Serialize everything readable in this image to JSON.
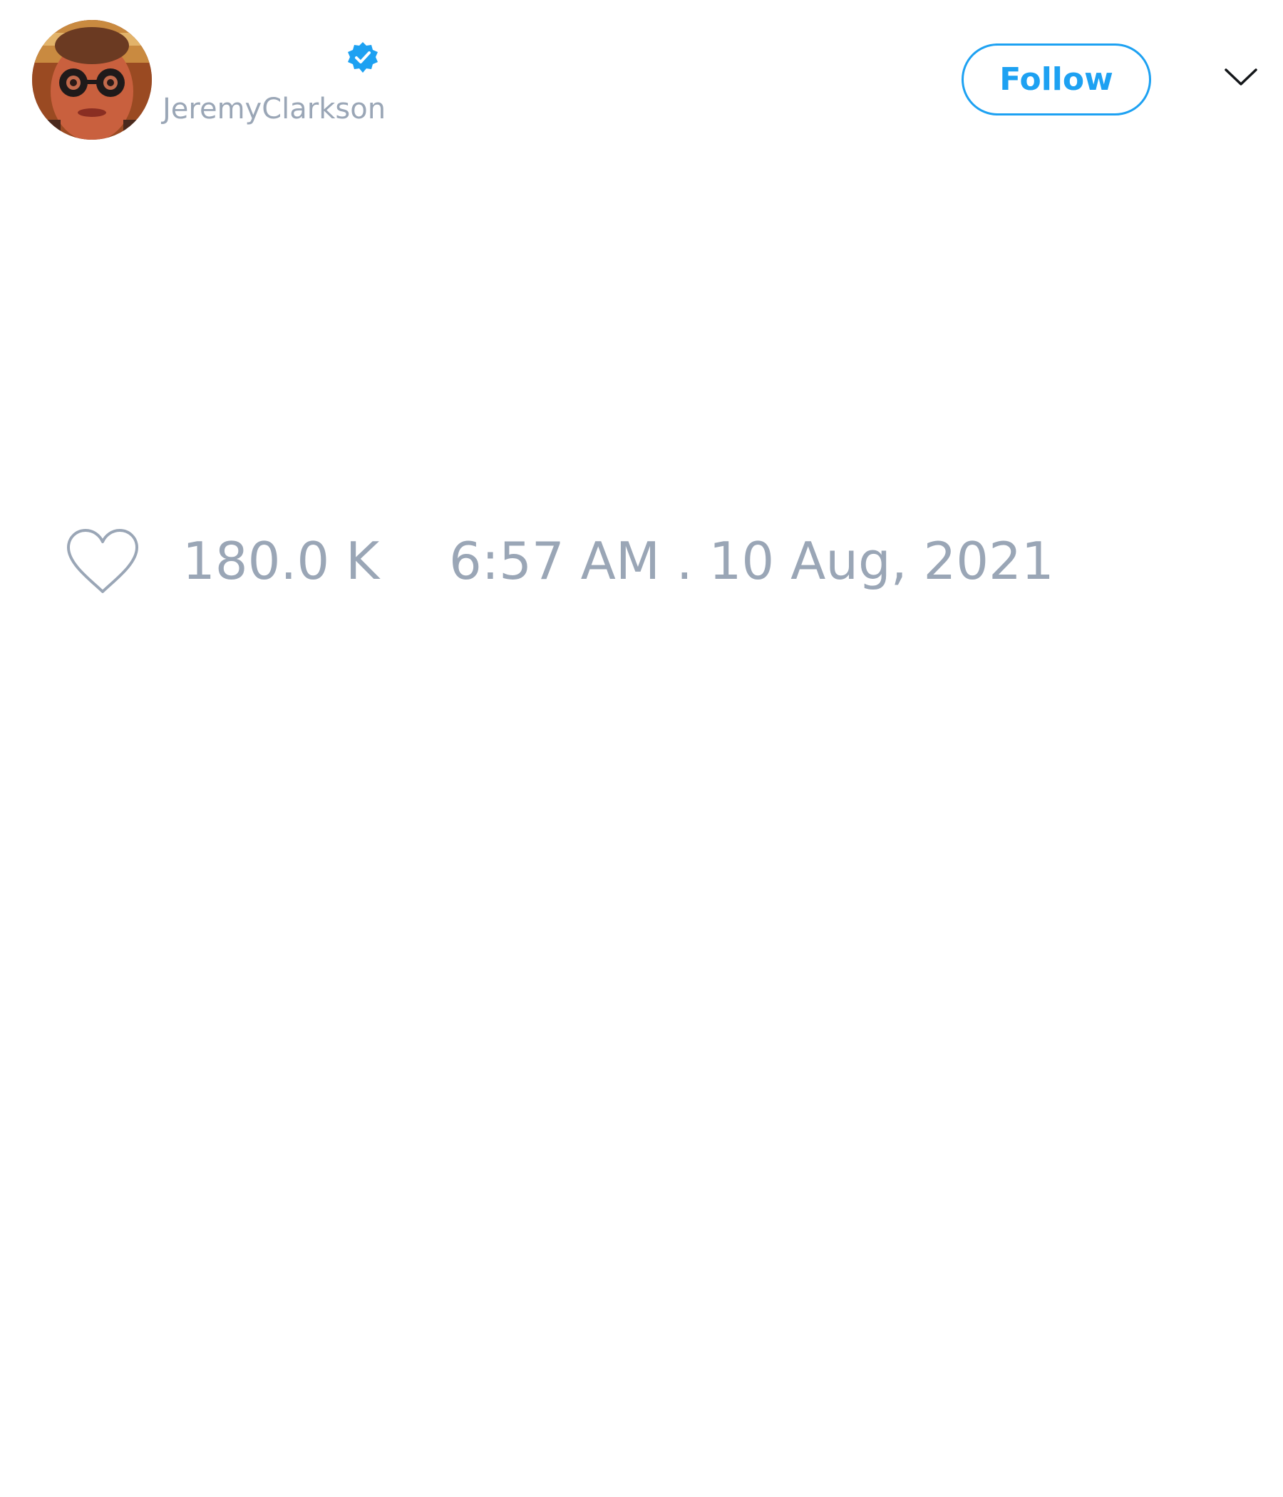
{
  "tweet": {
    "author": {
      "display_name": "",
      "handle": "JeremyClarkson",
      "verified": true
    },
    "follow_label": "Follow",
    "menu_icon": "chevron-down-icon",
    "likes": "180.0 K",
    "timestamp": "6:57 AM . 10 Aug, 2021"
  },
  "colors": {
    "accent": "#1da1f2",
    "muted_text": "#9aa6b6",
    "background": "#ffffff"
  }
}
